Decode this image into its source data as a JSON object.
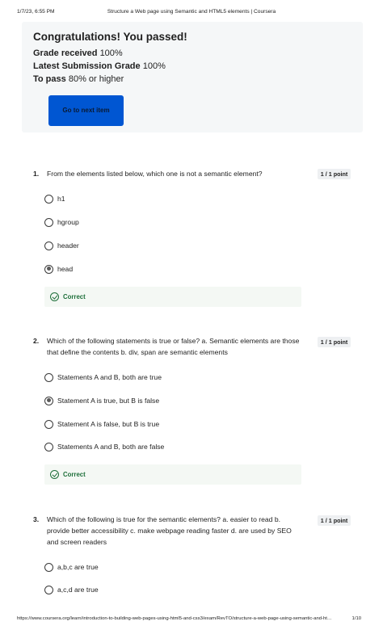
{
  "print_header": {
    "datetime": "1/7/23, 6:55 PM",
    "page_title": "Structure a Web page using Semantic and HTML5 elements | Coursera"
  },
  "result": {
    "heading": "Congratulations! You passed!",
    "grade_received_label": "Grade received",
    "grade_received_value": "100%",
    "latest_grade_label": "Latest Submission Grade",
    "latest_grade_value": "100%",
    "to_pass_label": "To pass",
    "to_pass_value": "80% or higher",
    "next_button": "Go to next item"
  },
  "questions": [
    {
      "number": "1.",
      "text": "From the elements listed below, which one is not a semantic element?",
      "points": "1 / 1 point",
      "options": [
        {
          "label": "h1",
          "selected": false
        },
        {
          "label": "hgroup",
          "selected": false
        },
        {
          "label": "header",
          "selected": false
        },
        {
          "label": "head",
          "selected": true
        }
      ],
      "feedback": "Correct"
    },
    {
      "number": "2.",
      "text": "Which of the following statements is true or false? a. Semantic elements are those that define the contents b. div, span are semantic elements",
      "points": "1 / 1 point",
      "options": [
        {
          "label": "Statements A and B, both are true",
          "selected": false
        },
        {
          "label": "Statement A is true, but B is false",
          "selected": true
        },
        {
          "label": "Statement A is false, but B is true",
          "selected": false
        },
        {
          "label": "Statements A and B, both are false",
          "selected": false
        }
      ],
      "feedback": "Correct"
    },
    {
      "number": "3.",
      "text": "Which of the following is true for the semantic elements? a. easier to read b. provide better accessibility c. make webpage reading faster d. are used by SEO and screen readers",
      "points": "1 / 1 point",
      "options": [
        {
          "label": "a,b,c are true",
          "selected": false
        },
        {
          "label": "a,c,d are true",
          "selected": false
        }
      ]
    }
  ],
  "print_footer": {
    "url": "https://www.coursera.org/learn/introduction-to-building-web-pages-using-html5-and-css3/exam/RevTO/structure-a-web-page-using-semantic-and-ht…",
    "page": "1/10"
  },
  "colors": {
    "accent": "#0056d2",
    "correct": "#1e6f3a",
    "card_background": "#f5f7f8"
  }
}
